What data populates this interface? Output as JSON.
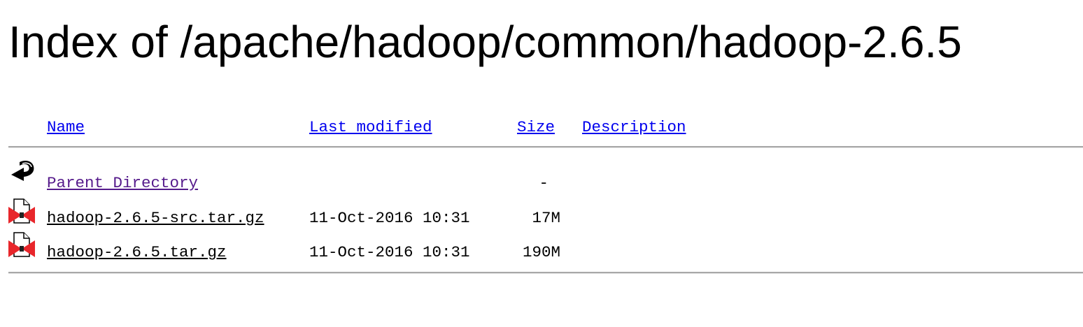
{
  "title": "Index of /apache/hadoop/common/hadoop-2.6.5",
  "columns": {
    "name": "Name",
    "last_modified": "Last modified",
    "size": "Size",
    "description": "Description"
  },
  "rows": [
    {
      "icon": "back-icon",
      "name": "Parent Directory",
      "modified": "",
      "size": "-",
      "description": ""
    },
    {
      "icon": "compressed-file-icon",
      "name": "hadoop-2.6.5-src.tar.gz",
      "modified": "11-Oct-2016 10:31",
      "size": "17M",
      "description": ""
    },
    {
      "icon": "compressed-file-icon",
      "name": "hadoop-2.6.5.tar.gz",
      "modified": "11-Oct-2016 10:31",
      "size": "190M",
      "description": ""
    }
  ]
}
